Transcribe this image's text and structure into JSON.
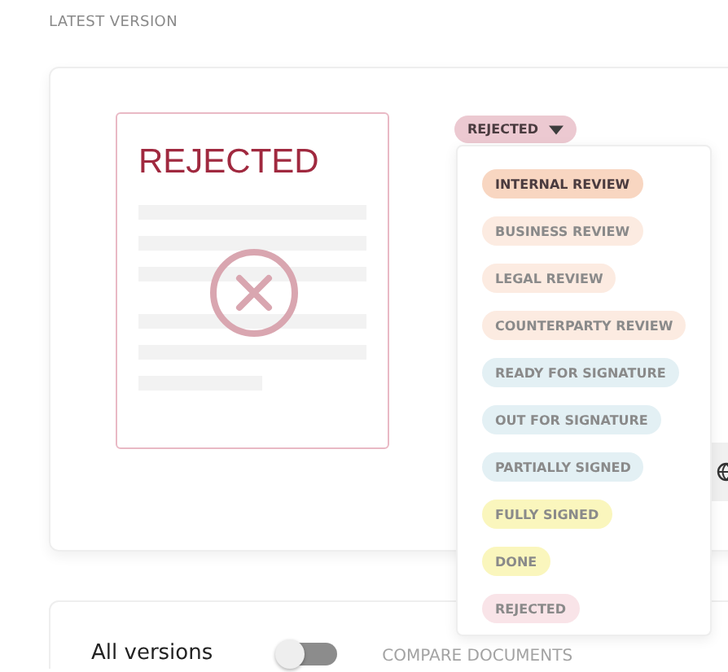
{
  "section_label": "LATEST VERSION",
  "document": {
    "status_title": "REJECTED"
  },
  "status_badge": {
    "label": "REJECTED",
    "color": "#ecc9d1"
  },
  "status_menu": [
    {
      "label": "INTERNAL REVIEW",
      "color": "#f8d6c1",
      "highlighted": true
    },
    {
      "label": "BUSINESS REVIEW",
      "color": "#fcebe1",
      "highlighted": false
    },
    {
      "label": "LEGAL REVIEW",
      "color": "#fcebe1",
      "highlighted": false
    },
    {
      "label": "COUNTERPARTY REVIEW",
      "color": "#fcebe1",
      "highlighted": false
    },
    {
      "label": "READY FOR SIGNATURE",
      "color": "#e3f0f4",
      "highlighted": false
    },
    {
      "label": "OUT FOR SIGNATURE",
      "color": "#e3f0f4",
      "highlighted": false
    },
    {
      "label": "PARTIALLY SIGNED",
      "color": "#e3f0f4",
      "highlighted": false
    },
    {
      "label": "FULLY SIGNED",
      "color": "#faf6bd",
      "highlighted": false
    },
    {
      "label": "DONE",
      "color": "#faf6bd",
      "highlighted": false
    },
    {
      "label": "REJECTED",
      "color": "#f9e4e8",
      "highlighted": false
    }
  ],
  "versions": {
    "title": "All versions",
    "compare_toggle": {
      "on": false
    },
    "compare_label": "COMPARE DOCUMENTS"
  }
}
